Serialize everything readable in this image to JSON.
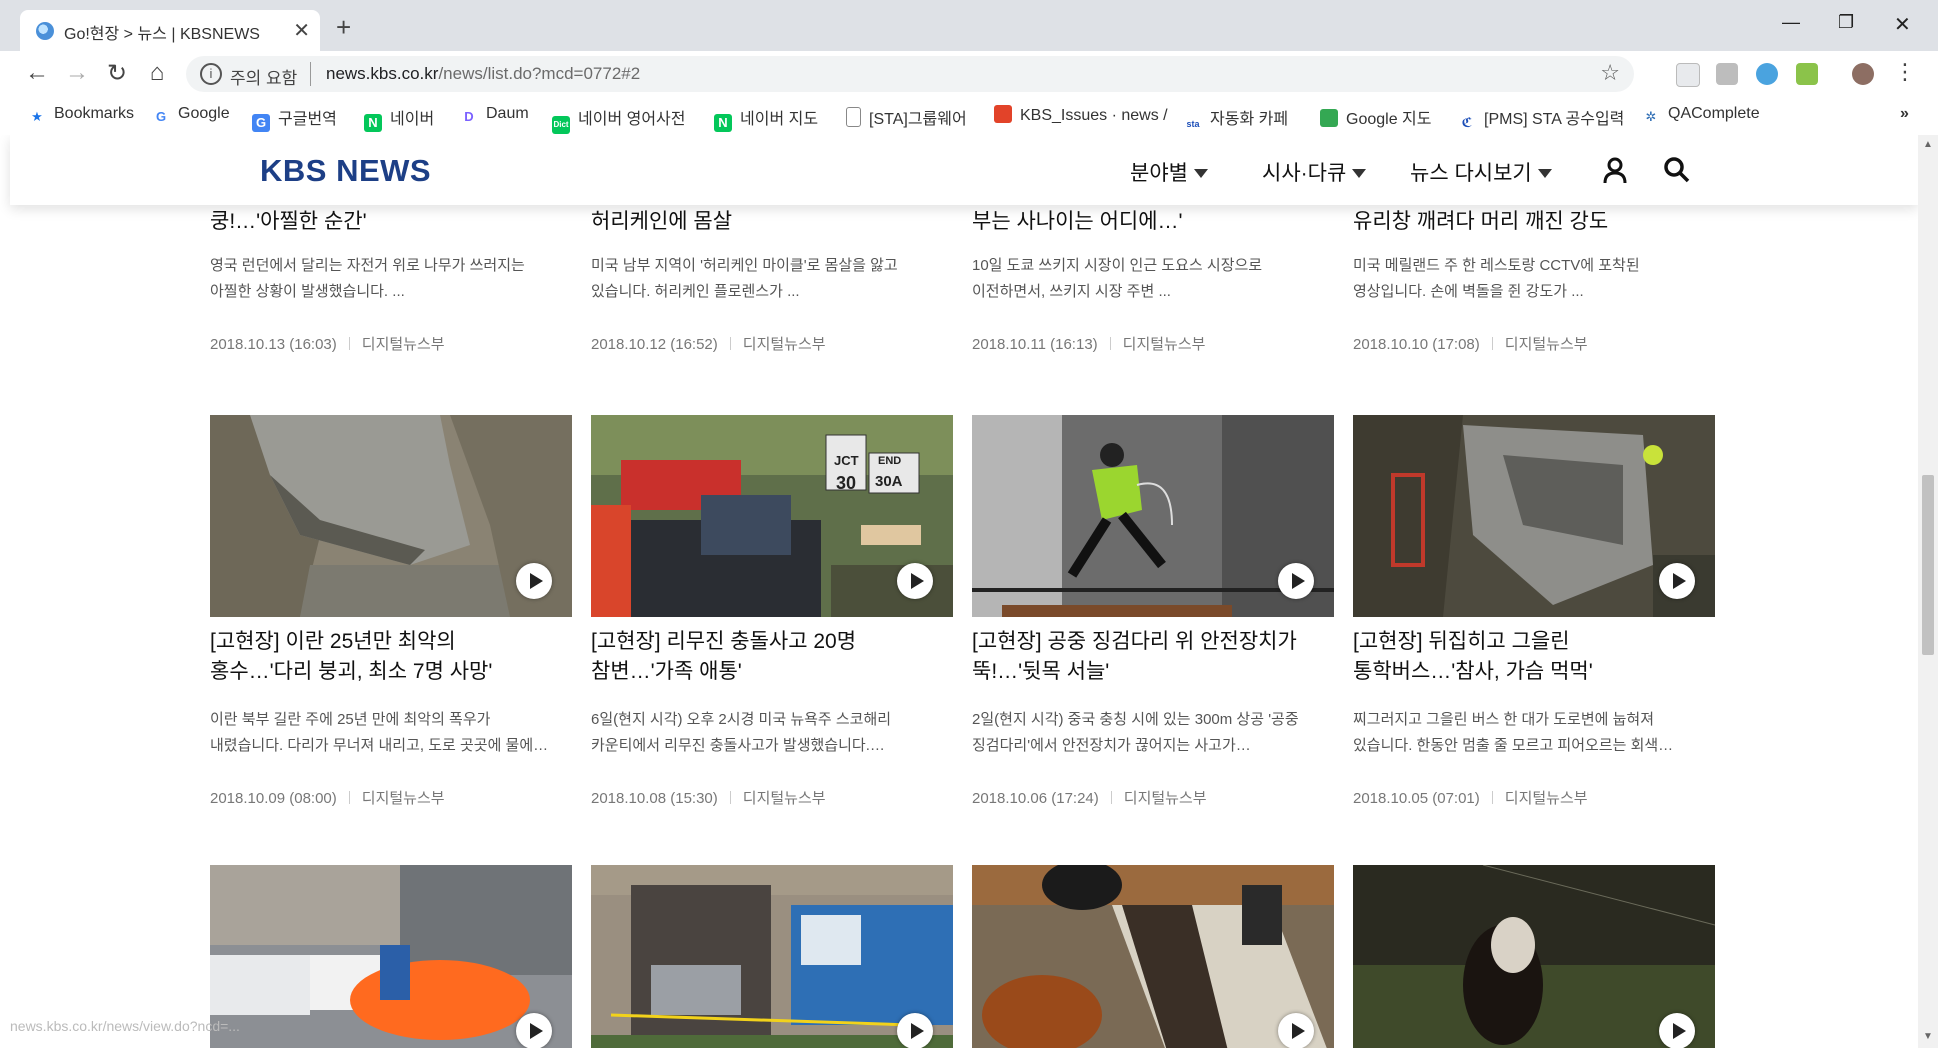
{
  "browser": {
    "tab_title": "Go!현장 > 뉴스 | KBSNEWS",
    "security_label": "주의 요함",
    "url_domain": "news.kbs.co.kr",
    "url_path": "/news/list.do?mcd=0772#2",
    "bookmarks": [
      {
        "label": "Bookmarks",
        "icon": "star-icon",
        "color": "#1a73e8"
      },
      {
        "label": "Google",
        "icon": "google-icon",
        "color": "#4285f4"
      },
      {
        "label": "구글번역",
        "icon": "translate-icon",
        "color": "#4285f4"
      },
      {
        "label": "네이버",
        "icon": "naver-icon",
        "color": "#03c75a"
      },
      {
        "label": "Daum",
        "icon": "daum-icon",
        "color": "#7b61ff"
      },
      {
        "label": "네이버 영어사전",
        "icon": "naver-dict-icon",
        "color": "#03c75a"
      },
      {
        "label": "네이버 지도",
        "icon": "naver-map-icon",
        "color": "#03c75a"
      },
      {
        "label": "[STA]그룹웨어",
        "icon": "page-icon",
        "color": "#888888"
      },
      {
        "label": "KBS_Issues · news / ",
        "icon": "gitlab-icon",
        "color": "#e24329"
      },
      {
        "label": "자동화 카페",
        "icon": "cafe-icon",
        "color": "#1d4fb8"
      },
      {
        "label": "Google 지도",
        "icon": "maps-icon",
        "color": "#34a853"
      },
      {
        "label": "[PMS] STA 공수입력",
        "icon": "pms-icon",
        "color": "#1d4fb8"
      },
      {
        "label": "QAComplete",
        "icon": "qa-icon",
        "color": "#2e6db4"
      }
    ],
    "more_bookmarks": "»"
  },
  "site": {
    "logo": "KBS NEWS",
    "menu": [
      "분야별",
      "시사·다큐",
      "뉴스 다시보기"
    ]
  },
  "cards_top": [
    {
      "title": "쿵!…'아찔한 순간'",
      "desc": "영국 런던에서 달리는 자전거 위로 나무가 쓰러지는\n아찔한 상황이 발생했습니다. ...",
      "date": "2018.10.13 (16:03)",
      "author": "디지털뉴스부"
    },
    {
      "title": "허리케인에 몸살",
      "desc": "미국 남부 지역이 '허리케인 마이클'로 몸살을 앓고\n있습니다. 허리케인 플로렌스가 ...",
      "date": "2018.10.12 (16:52)",
      "author": "디지털뉴스부"
    },
    {
      "title": "부는 사나이는 어디에…'",
      "desc": "10일 도쿄 쓰키지 시장이 인근 도요스 시장으로\n이전하면서, 쓰키지 시장 주변 ...",
      "date": "2018.10.11 (16:13)",
      "author": "디지털뉴스부"
    },
    {
      "title": "유리창 깨려다 머리 깨진 강도",
      "desc": "미국 메릴랜드 주 한 레스토랑 CCTV에 포착된\n영상입니다. 손에 벽돌을 쥔 강도가 ...",
      "date": "2018.10.10 (17:08)",
      "author": "디지털뉴스부"
    }
  ],
  "cards_mid": [
    {
      "title": "[고현장] 이란 25년만 최악의\n홍수…'다리 붕괴, 최소 7명 사망'",
      "desc": "이란 북부 길란 주에 25년 만에 최악의 폭우가\n내렸습니다. 다리가 무너져 내리고, 도로 곳곳에 물에…",
      "date": "2018.10.09 (08:00)",
      "author": "디지털뉴스부"
    },
    {
      "title": "[고현장] 리무진 충돌사고 20명\n참변…'가족 애통'",
      "desc": "6일(현지 시각) 오후 2시경 미국 뉴욕주 스코해리\n카운티에서 리무진 충돌사고가 발생했습니다.…",
      "date": "2018.10.08 (15:30)",
      "author": "디지털뉴스부",
      "sign1": "JCT",
      "sign2": "END",
      "sign3": "30",
      "sign4": "30A"
    },
    {
      "title": "[고현장] 공중 징검다리 위 안전장치가\n뚝!…'뒷목 서늘'",
      "desc": "2일(현지 시각) 중국 충칭 시에 있는 300m 상공 '공중\n징검다리'에서 안전장치가 끊어지는 사고가…",
      "date": "2018.10.06 (17:24)",
      "author": "디지털뉴스부"
    },
    {
      "title": "[고현장] 뒤집히고 그을린\n통학버스…'참사, 가슴 먹먹'",
      "desc": "찌그러지고 그을린 버스 한 대가 도로변에 눕혀져\n있습니다. 한동안 멈출 줄 모르고 피어오르는 회색…",
      "date": "2018.10.05 (07:01)",
      "author": "디지털뉴스부"
    }
  ],
  "status_url": "news.kbs.co.kr/news/view.do?ncd=..."
}
